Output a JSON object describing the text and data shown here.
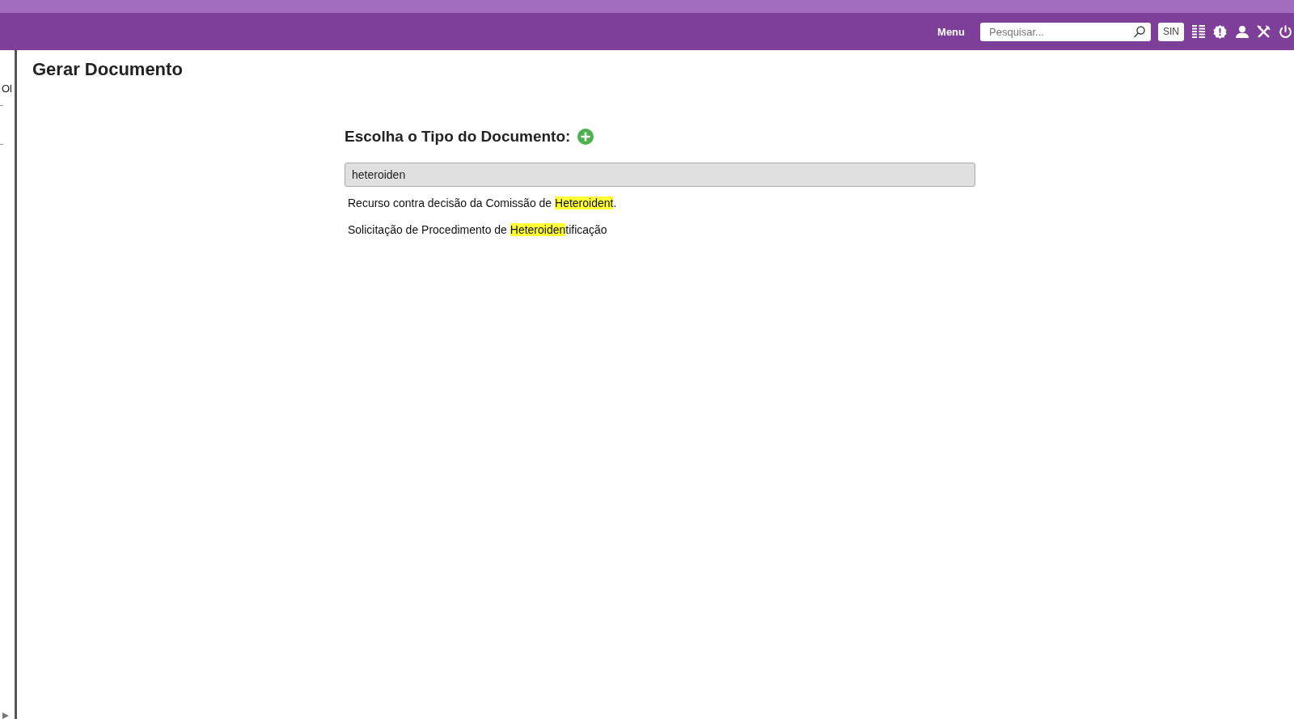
{
  "header": {
    "menu_label": "Menu",
    "search": {
      "placeholder": "Pesquisar..."
    },
    "unit_badge": "SIN"
  },
  "sidebar": {
    "text": "Ol"
  },
  "page_title": "Gerar Documento",
  "document_type": {
    "label": "Escolha o Tipo do Documento:",
    "filter": {
      "value": "heteroiden"
    },
    "results": [
      {
        "segments": [
          {
            "text": "Recurso contra decisão da Comissão de ",
            "highlighted": false
          },
          {
            "text": "Heteroident",
            "highlighted": true
          },
          {
            "text": ".",
            "highlighted": false
          }
        ]
      },
      {
        "segments": [
          {
            "text": "Solicitação de Procedimento de ",
            "highlighted": false
          },
          {
            "text": "Heteroiden",
            "highlighted": true
          },
          {
            "text": "tificação",
            "highlighted": false
          }
        ]
      }
    ]
  }
}
